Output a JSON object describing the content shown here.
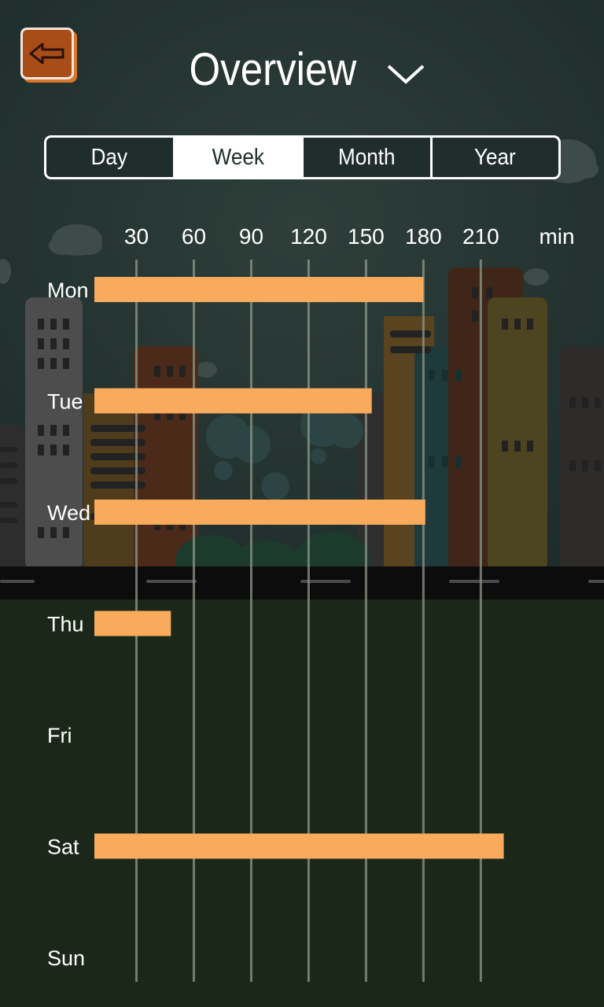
{
  "header": {
    "title": "Overview"
  },
  "tabs": [
    {
      "label": "Day",
      "active": false
    },
    {
      "label": "Week",
      "active": true
    },
    {
      "label": "Month",
      "active": false
    },
    {
      "label": "Year",
      "active": false
    }
  ],
  "colors": {
    "bar": "#f8ab5d",
    "gridline": "#8f9a8a",
    "accent_button": "#a84d18"
  },
  "chart_data": {
    "type": "bar",
    "orientation": "horizontal",
    "unit_label": "min",
    "x_ticks": [
      30,
      60,
      90,
      120,
      150,
      180,
      210
    ],
    "xlim": [
      8,
      230
    ],
    "categories": [
      "Mon",
      "Tue",
      "Wed",
      "Thu",
      "Fri",
      "Sat",
      "Sun"
    ],
    "values": [
      180,
      153,
      181,
      48,
      0,
      222,
      0
    ]
  }
}
